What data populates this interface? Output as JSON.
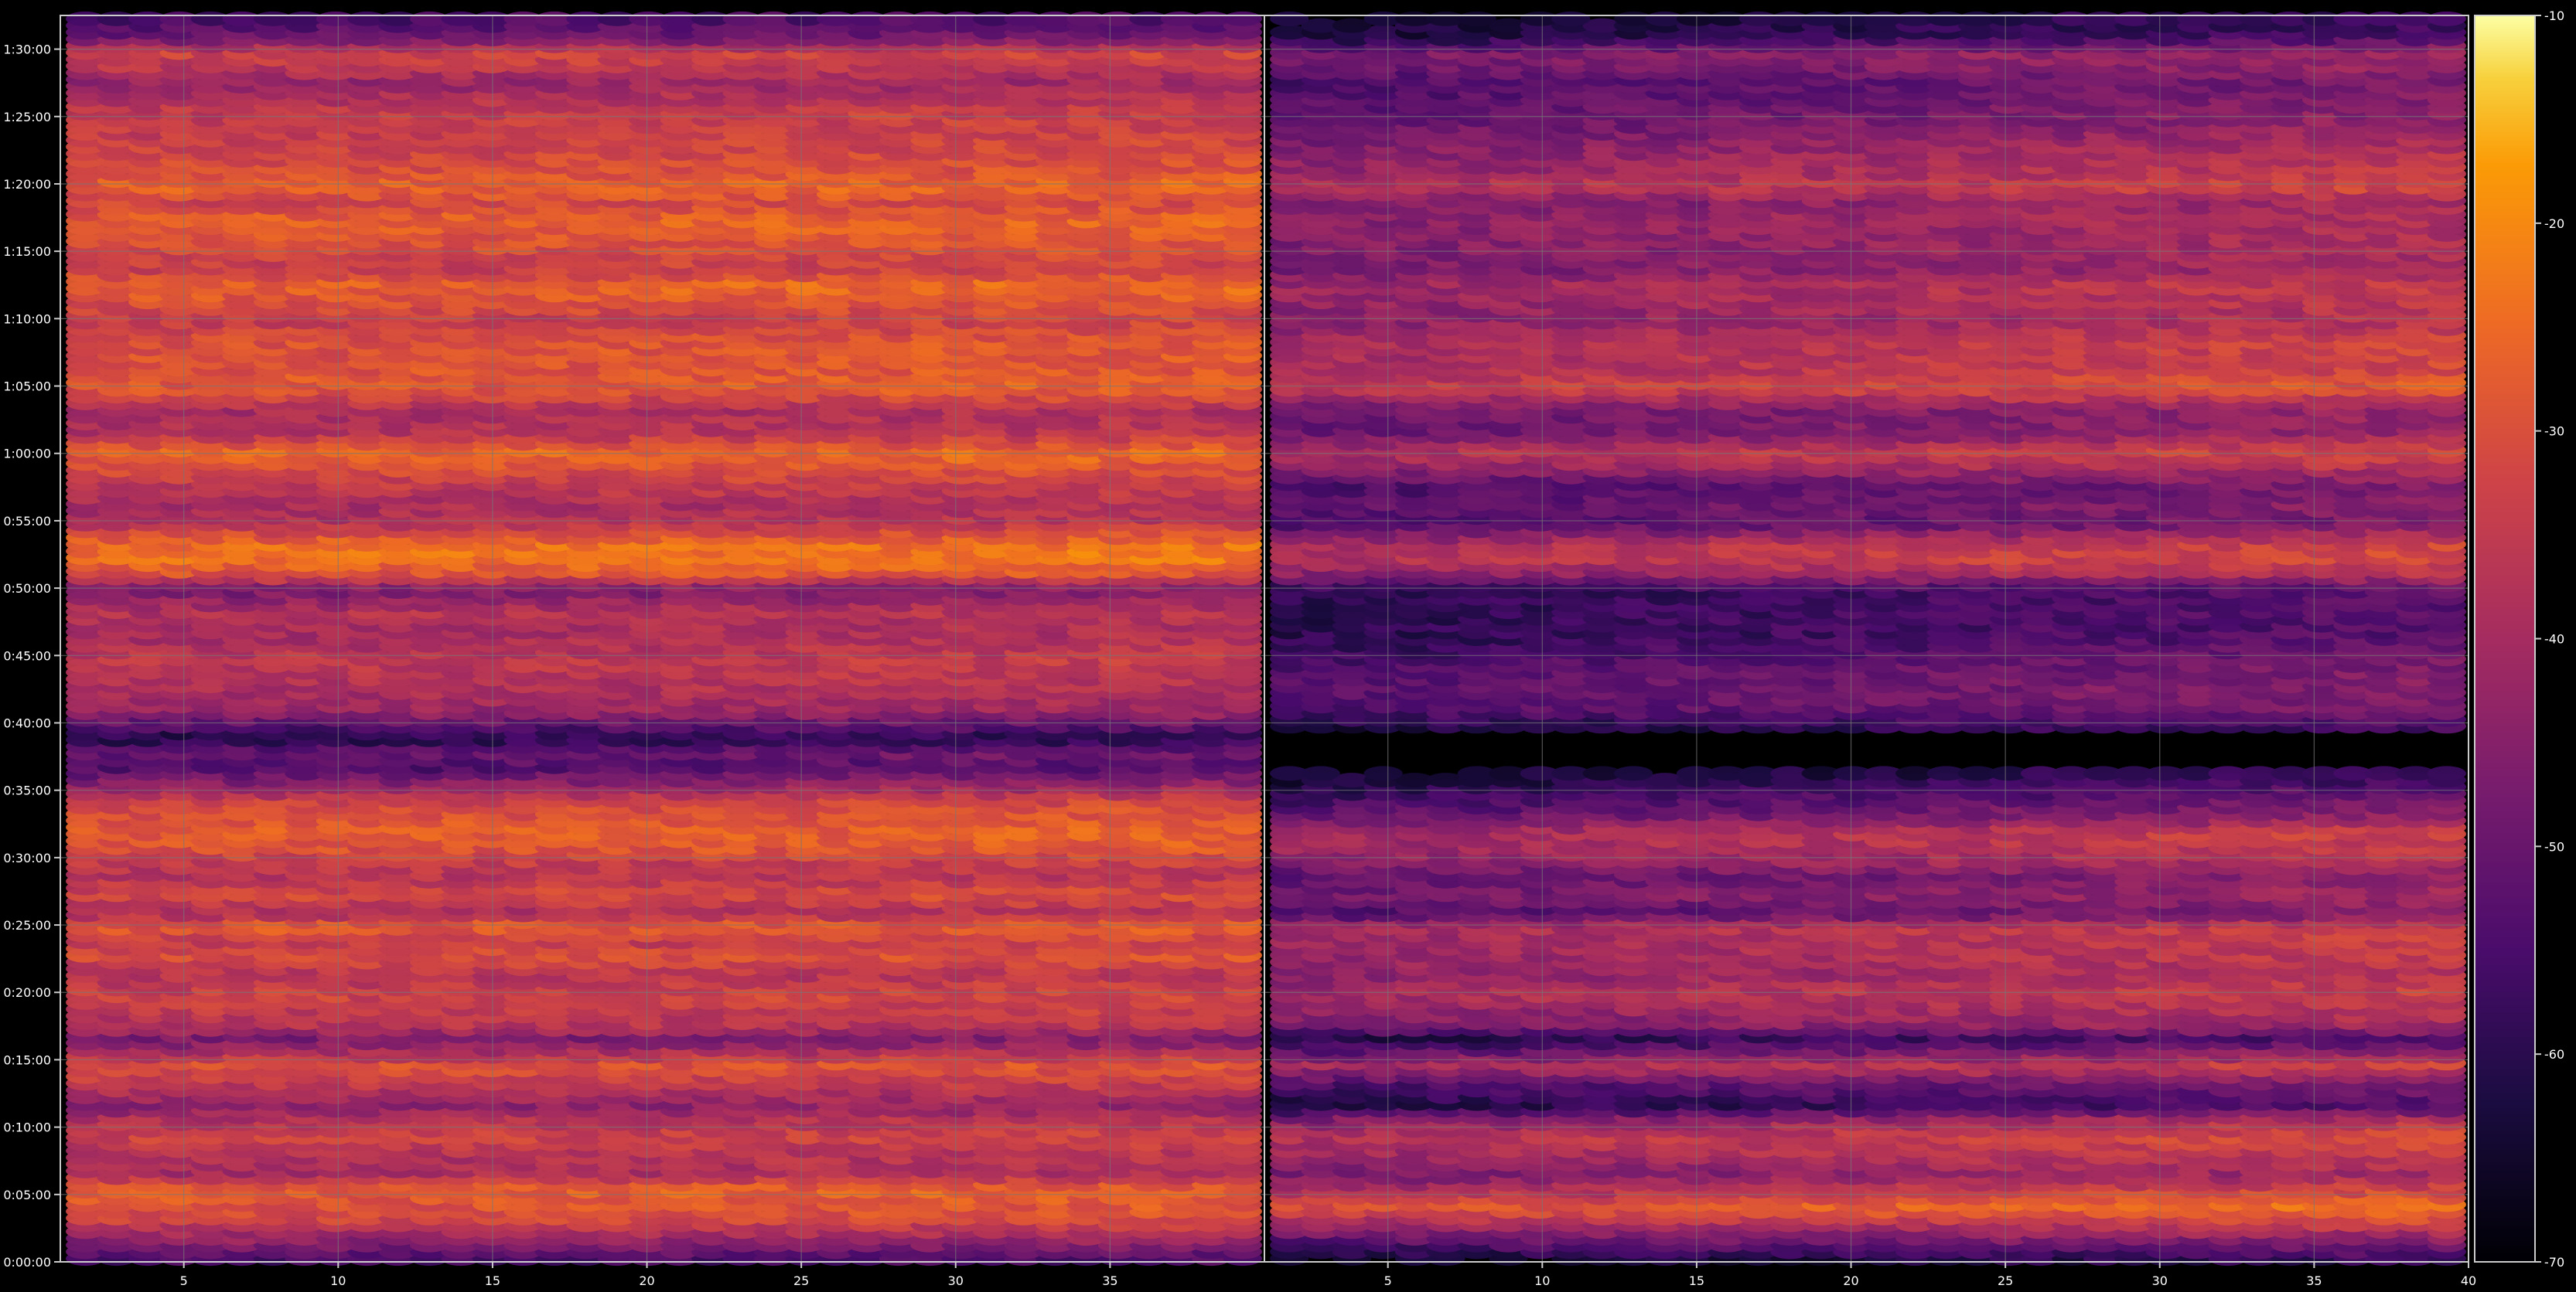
{
  "chart_data": [
    {
      "type": "heatmap",
      "panel": "left",
      "x_range": [
        1,
        40
      ],
      "x_ticks": [
        5,
        10,
        15,
        20,
        25,
        30,
        35
      ],
      "y_range_seconds": [
        0,
        5550
      ],
      "y_ticks": [
        "0:00:00",
        "0:05:00",
        "0:10:00",
        "0:15:00",
        "0:20:00",
        "0:25:00",
        "0:30:00",
        "0:35:00",
        "0:40:00",
        "0:45:00",
        "0:50:00",
        "0:55:00",
        "1:00:00",
        "1:05:00",
        "1:10:00",
        "1:15:00",
        "1:20:00",
        "1:25:00",
        "1:30:00"
      ],
      "y_tick_values_seconds": [
        0,
        300,
        600,
        900,
        1200,
        1500,
        1800,
        2100,
        2400,
        2700,
        3000,
        3300,
        3600,
        3900,
        4200,
        4500,
        4800,
        5100,
        5400
      ],
      "grid": true,
      "gap_bands_seconds": [
        [
          2340,
          2400
        ],
        [
          2130,
          2160
        ],
        [
          900,
          960
        ],
        [
          4480,
          4560
        ]
      ],
      "intensity_profile_db": [
        [
          0,
          -58
        ],
        [
          100,
          -45
        ],
        [
          200,
          -32
        ],
        [
          260,
          -30
        ],
        [
          330,
          -27
        ],
        [
          400,
          -40
        ],
        [
          500,
          -38
        ],
        [
          560,
          -33
        ],
        [
          640,
          -38
        ],
        [
          700,
          -45
        ],
        [
          800,
          -36
        ],
        [
          880,
          -30
        ],
        [
          1000,
          -48
        ],
        [
          1060,
          -38
        ],
        [
          1200,
          -33
        ],
        [
          1280,
          -38
        ],
        [
          1320,
          -35
        ],
        [
          1380,
          -30
        ],
        [
          1430,
          -36
        ],
        [
          1500,
          -27
        ],
        [
          1560,
          -40
        ],
        [
          1640,
          -32
        ],
        [
          1730,
          -38
        ],
        [
          1790,
          -35
        ],
        [
          1850,
          -30
        ],
        [
          1920,
          -28
        ],
        [
          1980,
          -30
        ],
        [
          2050,
          -33
        ],
        [
          2210,
          -55
        ],
        [
          2270,
          -50
        ],
        [
          2340,
          -62
        ],
        [
          2460,
          -43
        ],
        [
          2540,
          -40
        ],
        [
          2680,
          -36
        ],
        [
          2790,
          -40
        ],
        [
          2850,
          -40
        ],
        [
          2900,
          -38
        ],
        [
          3000,
          -48
        ],
        [
          3070,
          -30
        ],
        [
          3140,
          -24
        ],
        [
          3200,
          -25
        ],
        [
          3300,
          -38
        ],
        [
          3370,
          -40
        ],
        [
          3460,
          -36
        ],
        [
          3540,
          -31
        ],
        [
          3610,
          -26
        ],
        [
          3700,
          -38
        ],
        [
          3800,
          -40
        ],
        [
          3900,
          -28
        ],
        [
          3980,
          -30
        ],
        [
          4100,
          -30
        ],
        [
          4200,
          -35
        ],
        [
          4360,
          -26
        ],
        [
          4420,
          -35
        ],
        [
          4650,
          -27
        ],
        [
          4720,
          -33
        ],
        [
          4800,
          -26
        ],
        [
          4840,
          -30
        ],
        [
          4940,
          -33
        ],
        [
          5060,
          -35
        ],
        [
          5130,
          -35
        ],
        [
          5260,
          -43
        ],
        [
          5330,
          -36
        ],
        [
          5390,
          -33
        ],
        [
          5460,
          -50
        ],
        [
          5530,
          -55
        ]
      ]
    },
    {
      "type": "heatmap",
      "panel": "right",
      "x_range": [
        1,
        40
      ],
      "x_ticks": [
        5,
        10,
        15,
        20,
        25,
        30,
        35,
        40
      ],
      "grid": true,
      "note_visible": "",
      "intensity_profile_db": [
        [
          0,
          -68
        ],
        [
          250,
          -30
        ],
        [
          330,
          -40
        ],
        [
          400,
          -48
        ],
        [
          480,
          -42
        ],
        [
          560,
          -38
        ],
        [
          640,
          -45
        ],
        [
          700,
          -62
        ],
        [
          800,
          -55
        ],
        [
          880,
          -40
        ],
        [
          1000,
          -62
        ],
        [
          1060,
          -48
        ],
        [
          1200,
          -40
        ],
        [
          1280,
          -45
        ],
        [
          1380,
          -42
        ],
        [
          1430,
          -42
        ],
        [
          1500,
          -40
        ],
        [
          1560,
          -55
        ],
        [
          1640,
          -48
        ],
        [
          1730,
          -52
        ],
        [
          1790,
          -45
        ],
        [
          1850,
          -42
        ],
        [
          1920,
          -40
        ],
        [
          1980,
          -50
        ],
        [
          2050,
          -55
        ],
        [
          2210,
          -68
        ],
        [
          2340,
          -68
        ],
        [
          2460,
          -55
        ],
        [
          2540,
          -52
        ],
        [
          2680,
          -55
        ],
        [
          2790,
          -60
        ],
        [
          2900,
          -60
        ],
        [
          3000,
          -60
        ],
        [
          3070,
          -45
        ],
        [
          3140,
          -38
        ],
        [
          3200,
          -40
        ],
        [
          3300,
          -55
        ],
        [
          3370,
          -52
        ],
        [
          3460,
          -55
        ],
        [
          3540,
          -45
        ],
        [
          3610,
          -38
        ],
        [
          3700,
          -50
        ],
        [
          3800,
          -50
        ],
        [
          3900,
          -35
        ],
        [
          3980,
          -40
        ],
        [
          4100,
          -40
        ],
        [
          4200,
          -45
        ],
        [
          4360,
          -42
        ],
        [
          4420,
          -48
        ],
        [
          4650,
          -45
        ],
        [
          4720,
          -48
        ],
        [
          4800,
          -38
        ],
        [
          4840,
          -42
        ],
        [
          4940,
          -45
        ],
        [
          5060,
          -50
        ],
        [
          5130,
          -52
        ],
        [
          5260,
          -55
        ],
        [
          5330,
          -50
        ],
        [
          5390,
          -48
        ],
        [
          5460,
          -62
        ],
        [
          5530,
          -65
        ]
      ]
    }
  ],
  "colorbar": {
    "min": -70,
    "max": -10,
    "ticks": [
      "-10",
      "-20",
      "-30",
      "-40",
      "-50",
      "-60",
      "-70"
    ],
    "tick_values": [
      -10,
      -20,
      -30,
      -40,
      -50,
      -60,
      -70
    ],
    "colormap": "inferno"
  },
  "colors": {
    "background": "#000000",
    "grid": "#777777",
    "axis": "#cccccc",
    "text": "#ffffff"
  }
}
